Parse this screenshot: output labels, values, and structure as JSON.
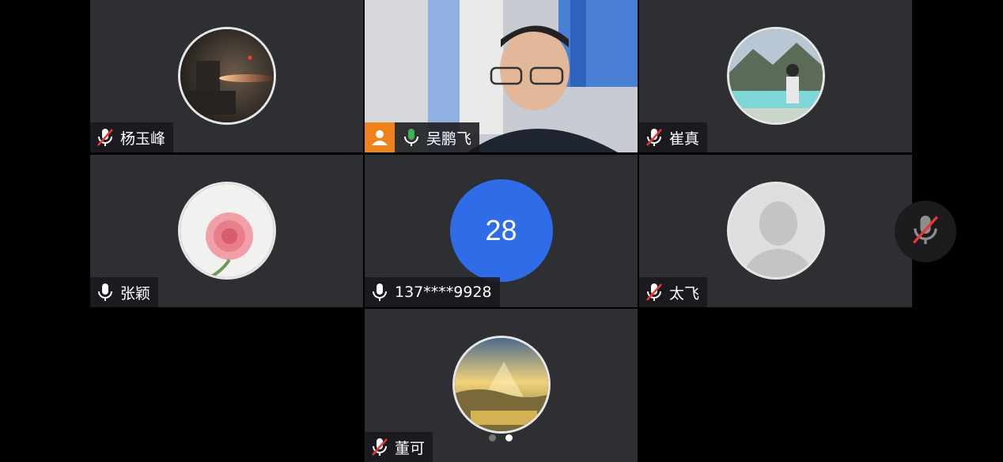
{
  "participants": [
    {
      "name": "杨玉峰",
      "mic": "muted"
    },
    {
      "name": "吴鹏飞",
      "mic": "on",
      "role": "host"
    },
    {
      "name": "崔真",
      "mic": "muted"
    },
    {
      "name": "张颖",
      "mic": "on"
    },
    {
      "name": "137****9928",
      "mic": "on",
      "avatar_text": "28"
    },
    {
      "name": "太飞",
      "mic": "muted"
    },
    {
      "name": "董可",
      "mic": "muted"
    }
  ],
  "pagination": {
    "current_page": 2,
    "total_pages": 2
  },
  "colors": {
    "active_border": "#3fb34f",
    "host_badge": "#f0821e",
    "number_avatar": "#2f6de8",
    "tile_bg": "#2e2f33"
  }
}
